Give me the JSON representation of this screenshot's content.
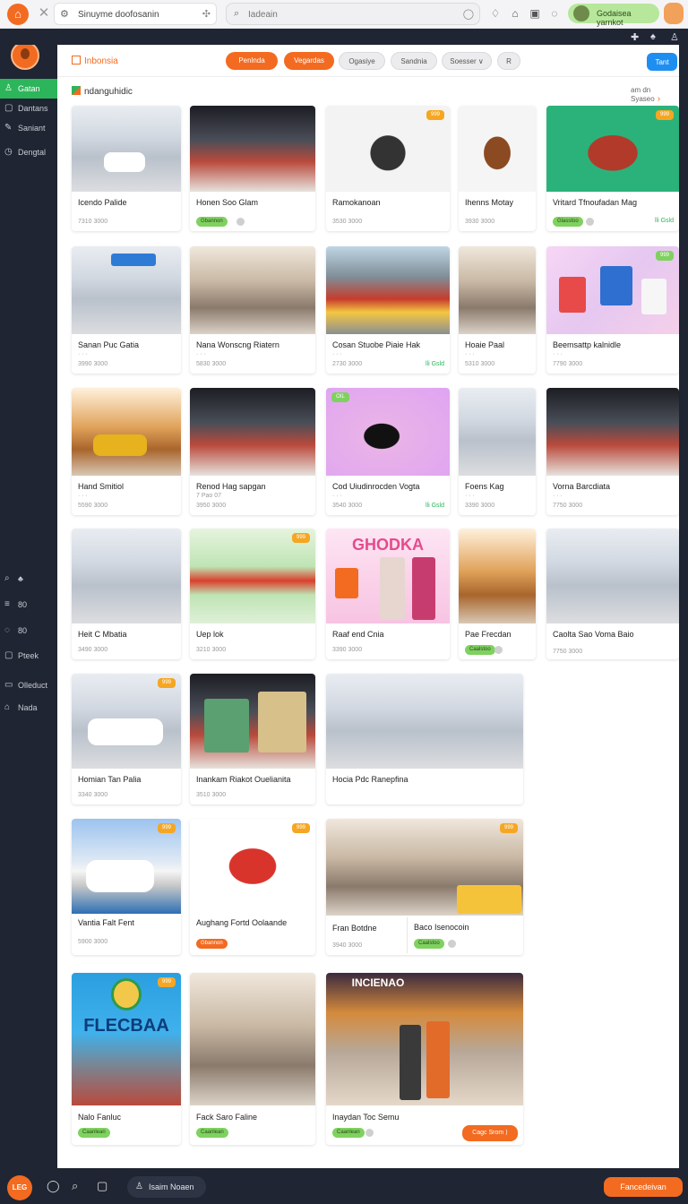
{
  "topbar": {
    "address": "Sinuyme doofosanin",
    "search_placeholder": "Iadeain",
    "user_label": "Godaisea yarnkot",
    "logo_glyph": "⌂"
  },
  "sidebar": {
    "items": [
      {
        "label": "Gatan",
        "icon": "user-icon",
        "glyph": "♙"
      },
      {
        "label": "Dantans",
        "icon": "square-icon",
        "glyph": "▢"
      },
      {
        "label": "Saniant",
        "icon": "pen-icon",
        "glyph": "✎"
      },
      {
        "label": "Dengtal",
        "icon": "clock-icon",
        "glyph": "◷"
      },
      {
        "label": "",
        "icon": "search-icon",
        "glyph": "⌕"
      },
      {
        "label": "80",
        "icon": "list-icon",
        "glyph": "≡"
      },
      {
        "label": "80",
        "icon": "chat-icon",
        "glyph": "◌"
      },
      {
        "label": "Pteek",
        "icon": "box-icon",
        "glyph": "▢"
      },
      {
        "label": "Olleduct",
        "icon": "doc-icon",
        "glyph": "▭"
      },
      {
        "label": "Nada",
        "icon": "home-icon",
        "glyph": "⌂"
      }
    ],
    "active_color": "#2cb55a"
  },
  "toolbar": {
    "brand": "Inbonsia",
    "chips": [
      "Penlnda",
      "Vegardas",
      "Ogasiye",
      "Sandnia",
      "Soesser ∨",
      "R"
    ],
    "primary": "Tant"
  },
  "section": {
    "title": "ndanguhidic",
    "see_all": "am dn Syaseo"
  },
  "cards": [
    {
      "title": "Icendo Palide",
      "sub": "7310 3000"
    },
    {
      "title": "Honen Soo Glam",
      "badge": "Gbannon"
    },
    {
      "title": "Ramokanoan",
      "sub": "3530 3000",
      "tag": "999"
    },
    {
      "title": "Ihenns Motay",
      "sub": "3930 3000"
    },
    {
      "title": "Vritard Tfnoufadan Mag",
      "badge": "Glasstoo",
      "rbadge": "lli Gsld",
      "tag": "999"
    },
    {
      "title": "Sanan Puc Gatia",
      "sub1": "·  ·  ·",
      "sub": "3990 3000"
    },
    {
      "title": "Nana Wonscng Riatern",
      "sub1": "·  ·  ·",
      "sub": "5830 3000"
    },
    {
      "title": "Cosan Stuobe Piaie Hak",
      "sub1": "·  ·  ·",
      "sub": "2730 3000",
      "rbadge": "lli Gsld"
    },
    {
      "title": "Hoaie Paal",
      "sub1": "·  ·  ·",
      "sub": "5310 3000"
    },
    {
      "title": "Beemsattp kalnidle",
      "sub1": "·  ·  ·",
      "sub": "7790 3000",
      "tag": "999"
    },
    {
      "title": "Hand Smitiol",
      "sub1": "·  ·  ·",
      "sub": "5590 3000"
    },
    {
      "title": "Renod Hag sapgan",
      "sub1": "7 Pao 07",
      "sub": "3950 3000"
    },
    {
      "title": "Cod Uiudinrocden Vogta",
      "sub1": "·  ·  ·",
      "sub": "3540 3000",
      "rbadge": "lli Gsld",
      "tag": "OIL"
    },
    {
      "title": "Foens Kag",
      "sub1": "·  ·  ·",
      "sub": "3390 3000"
    },
    {
      "title": "Vorna Barcdiata",
      "sub1": "·  ·  ·",
      "sub": "7750 3000"
    },
    {
      "title": "Heit C Mbatia",
      "sub": "3490 3000"
    },
    {
      "title": "Uep lok",
      "sub": "3210 3000",
      "tag": "999"
    },
    {
      "title": "Raaf end Cnia",
      "sub": "3390 3000",
      "poster": "GHODKA"
    },
    {
      "title": "Pae Frecdan",
      "badge": "Caalstoo"
    },
    {
      "title": "Caolta Sao Voma Baio",
      "sub": "7750 3000"
    },
    {
      "title": "Homian Tan Palia",
      "sub": "3340 3000",
      "tag": "999"
    },
    {
      "title": "Inankam Riakot Ouelianita",
      "sub": "3510 3000"
    },
    {
      "title": "Hocia Pdc Ranepfina",
      "sub": ""
    },
    {
      "title": "Vantia Falt Fent",
      "sub": "5900 3000",
      "tag": "999"
    },
    {
      "title": "Aughang Fortd Oolaande",
      "badge": "Gbannon",
      "tag": "999"
    },
    {
      "title": "Fran Botdne",
      "sub": "3940 3000",
      "tag": "999"
    },
    {
      "title": "Baco Isenocoin",
      "badge": "Caalstoo"
    },
    {
      "title": "Nalo Fanluc",
      "badge": "Caanlean",
      "poster": "FLECBAA",
      "tag": "999"
    },
    {
      "title": "Fack Saro Faline",
      "badge": "Caanlean"
    },
    {
      "title": "Inaydan Toc Semu",
      "badge": "Caanlean",
      "cta": "Cagc Srom ⟩",
      "poster": "INCIENAO"
    }
  ],
  "bottombar": {
    "logo": "LEG",
    "pill": "Isaim Noaen",
    "button": "Fancedeivan"
  },
  "colors": {
    "accent": "#f26b21",
    "primary": "#1f8ef1",
    "frame": "#1f2532",
    "success": "#7fd160"
  }
}
